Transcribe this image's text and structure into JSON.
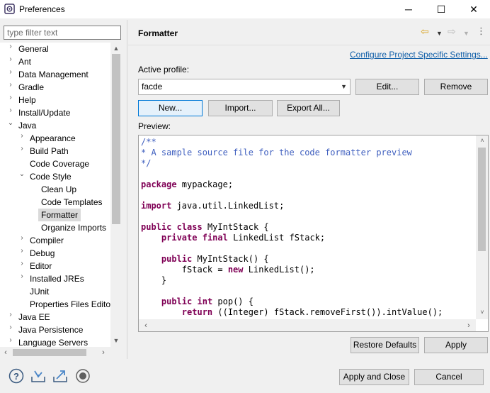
{
  "window": {
    "title": "Preferences",
    "minimize": "─",
    "maximize": "☐",
    "close": "✕"
  },
  "filter": {
    "placeholder": "type filter text",
    "value": ""
  },
  "tree": {
    "items": [
      {
        "label": "General",
        "expanded": false
      },
      {
        "label": "Ant",
        "expanded": false
      },
      {
        "label": "Data Management",
        "expanded": false
      },
      {
        "label": "Gradle",
        "expanded": false
      },
      {
        "label": "Help",
        "expanded": false
      },
      {
        "label": "Install/Update",
        "expanded": false
      },
      {
        "label": "Java",
        "expanded": true
      },
      {
        "label": "Appearance",
        "expanded": false
      },
      {
        "label": "Build Path",
        "expanded": false
      },
      {
        "label": "Code Coverage"
      },
      {
        "label": "Code Style",
        "expanded": true
      },
      {
        "label": "Clean Up"
      },
      {
        "label": "Code Templates"
      },
      {
        "label": "Formatter",
        "selected": true
      },
      {
        "label": "Organize Imports"
      },
      {
        "label": "Compiler",
        "expanded": false
      },
      {
        "label": "Debug",
        "expanded": false
      },
      {
        "label": "Editor",
        "expanded": false
      },
      {
        "label": "Installed JREs",
        "expanded": false
      },
      {
        "label": "JUnit"
      },
      {
        "label": "Properties Files Edito"
      },
      {
        "label": "Java EE",
        "expanded": false
      },
      {
        "label": "Java Persistence",
        "expanded": false
      },
      {
        "label": "Language Servers",
        "expanded": false
      }
    ]
  },
  "page": {
    "title": "Formatter",
    "link": "Configure Project Specific Settings...",
    "active_profile_label": "Active profile:",
    "profile_value": "facde",
    "edit_button": "Edit...",
    "remove_button": "Remove",
    "new_button": "New...",
    "import_button": "Import...",
    "export_button": "Export All...",
    "preview_label": "Preview:",
    "restore_button": "Restore Defaults",
    "apply_button": "Apply"
  },
  "footer": {
    "apply_close_button": "Apply and Close",
    "cancel_button": "Cancel"
  },
  "colors": {
    "keyword": "#7f0055",
    "comment": "#3f5fbf",
    "link": "#0f5ea8",
    "selection": "#dadada"
  }
}
